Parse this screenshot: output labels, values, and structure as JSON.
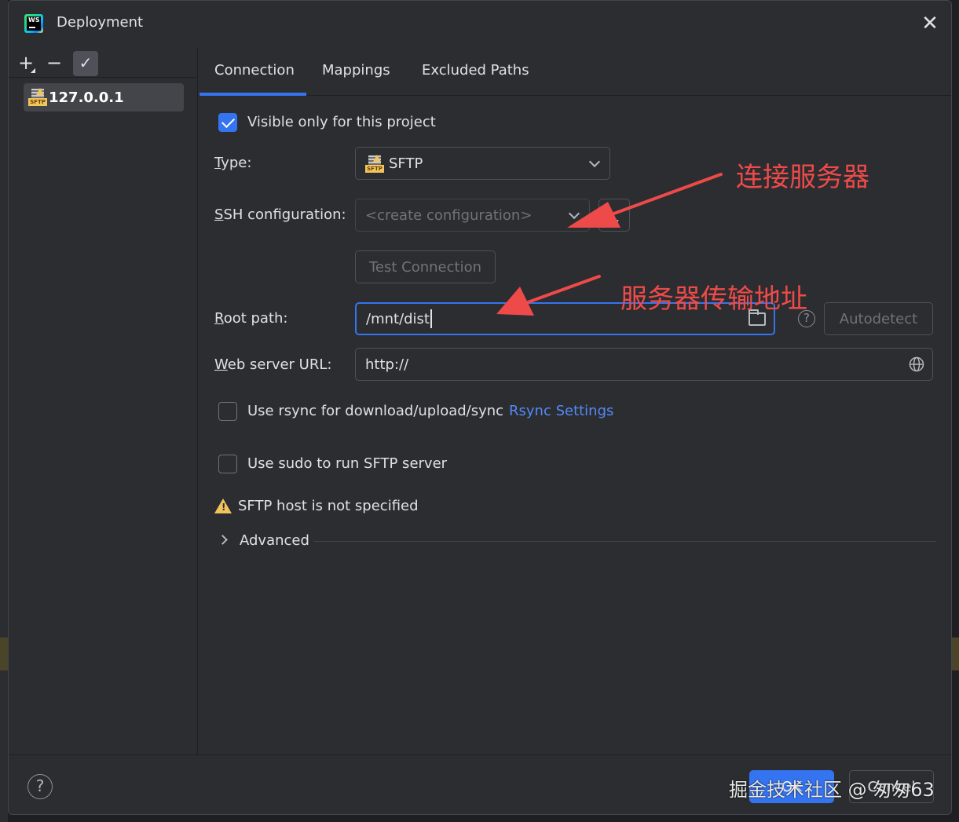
{
  "window": {
    "title": "Deployment",
    "app_icon_text": "WS"
  },
  "servers": [
    {
      "name": "127.0.0.1",
      "type_badge": "SFTP"
    }
  ],
  "tabs": [
    {
      "label": "Connection",
      "active": true
    },
    {
      "label": "Mappings",
      "active": false
    },
    {
      "label": "Excluded Paths",
      "active": false
    }
  ],
  "connection": {
    "visible_only_label": "Visible only for this project",
    "visible_only_checked": true,
    "type_label_pre": "",
    "type_label_mn": "T",
    "type_label_post": "ype:",
    "type_value": "SFTP",
    "type_badge": "SFTP",
    "ssh_label_mn": "S",
    "ssh_label_post": "SH configuration:",
    "ssh_placeholder": "<create configuration>",
    "ssh_more": "...",
    "test_connection": "Test Connection",
    "root_label_mn": "R",
    "root_label_post": "oot path:",
    "root_value": "/mnt/dist",
    "autodetect": "Autodetect",
    "help_glyph": "?",
    "web_label_mn": "W",
    "web_label_post": "eb server URL:",
    "web_value": "http://",
    "rsync_label": "Use rsync for download/upload/sync",
    "rsync_checked": false,
    "rsync_settings": "Rsync Settings",
    "sudo_label": "Use sudo to run SFTP server",
    "sudo_checked": false,
    "warning_text": "SFTP host is not specified",
    "advanced_label": "Advanced"
  },
  "footer": {
    "help_glyph": "?",
    "ok_label": "OK",
    "cancel_label": "Cancel"
  },
  "annotations": {
    "connect_server": "连接服务器",
    "transfer_path": "服务器传输地址",
    "color": "#ee4a4a"
  },
  "watermark": "掘金技术社区 @ 匆匆63",
  "colors": {
    "accent": "#3574f0",
    "link": "#548af7",
    "warning": "#f2c55c",
    "background": "#2b2d30"
  }
}
